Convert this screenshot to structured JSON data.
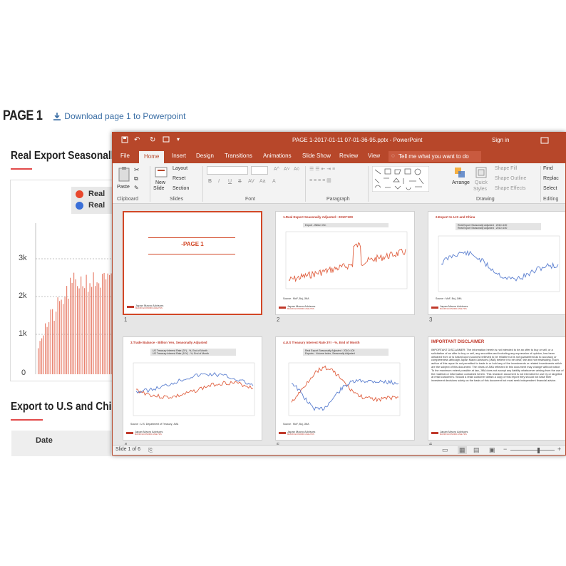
{
  "web": {
    "page_title": "PAGE 1",
    "download_link": "Download page 1 to Powerpoint",
    "section1_title": "Real Export Seasonally A",
    "legend": [
      "Real",
      "Real"
    ],
    "y_ticks": [
      "3k",
      "2k",
      "1k",
      "0"
    ],
    "section2_title": "Export to U.S and China",
    "table_header": "Date",
    "colors": {
      "accent_red": "#e24a4a",
      "legend_red": "#e8472d",
      "legend_blue": "#3a6fd8",
      "link_blue": "#3a6ea5"
    }
  },
  "ppt": {
    "title": "PAGE 1-2017-01-11 07-01-36-95.pptx  -  PowerPoint",
    "signin": "Sign in",
    "tabs": [
      "File",
      "Home",
      "Insert",
      "Design",
      "Transitions",
      "Animations",
      "Slide Show",
      "Review",
      "View"
    ],
    "tellme": "Tell me what you want to do",
    "ribbon": {
      "clipboard": {
        "paste": "Paste",
        "label": "Clipboard"
      },
      "slides": {
        "new_slide": "New",
        "new_slide2": "Slide",
        "layout": "Layout",
        "reset": "Reset",
        "section": "Section",
        "label": "Slides"
      },
      "font": {
        "label": "Font",
        "bold": "B",
        "italic": "I",
        "underline": "U",
        "strike": "S"
      },
      "paragraph": {
        "label": "Paragraph"
      },
      "drawing": {
        "arrange": "Arrange",
        "quick": "Quick",
        "styles": "Styles",
        "fill": "Shape Fill",
        "outline": "Shape Outline",
        "effects": "Shape Effects",
        "label": "Drawing"
      },
      "editing": {
        "find": "Find",
        "replace": "Replac",
        "select": "Select",
        "label": "Editing"
      }
    },
    "slides": [
      {
        "num": "1",
        "title": "-PAGE 1"
      },
      {
        "num": "2",
        "title": "1.Real Export Seasonally Adjusted : 2010=100",
        "legend": [
          "Export - Billion Yen"
        ],
        "source": "Source :  MoF, Boj, JMA"
      },
      {
        "num": "3",
        "title": "2.Export to U.S and China",
        "legend": [
          "Real Export Seasonally Adjusted : 2010=100",
          "Real Export Seasonally Adjusted : 2010=100"
        ],
        "source": "Source :  MoF, Boj, JMA"
      },
      {
        "num": "4",
        "title": "3.Trade Balance - Billion Yen, Seasonally Adjusted",
        "legend": [
          "US Treasury Interest Rate (3Y) - %, End of Month",
          "US Treasury Interest Rate (10Y) - %, End of Month"
        ],
        "source": "Source :  U.S. Department of Treasury, JMA"
      },
      {
        "num": "5",
        "title": "4.U.S Treasury Interest Rate 3Yr - %, End of Month",
        "legend": [
          "Real Export Seasonally Adjusted : 2010=100",
          "Exports - Volume Index, Seasonally Adjusted"
        ],
        "source": "Source :  MoF, Boj, JMA"
      },
      {
        "num": "6",
        "title": "IMPORTANT DISCLAIMER"
      }
    ],
    "logo_text": "Japan Macro Advisors",
    "logo_sub": "MACRO ECONOMIC ANALYSIS",
    "disclaimer_body": "IMPORTANT DISCLAIMER:  The information herein is not intended to be an offer to buy or sell, or a solicitation of an offer to buy or sell, any securities and including any expression of opinion, has been obtained from or is based upon sources believed to be reliable but is not guaranteed as to accuracy or completeness although Japan Macro Advisors (JMA) believe it to be clear, fair and not misleading. Each author of this report is not permitted to trade in or hold any of the investments or related investments which are the subject of this document. The views of JMA reflected in this document may change without notice. To the maximum extent possible at law, JMA does not accept any liability whatsoever arising from the use of the material or information contained herein. This research document is not intended for use by or targeted at retail customers. Should a retail customer obtain a copy of this report they should not base their investment decisions solely on the basis of this document but must seek independent financial advice.",
    "status": "Slide 1 of 6"
  }
}
